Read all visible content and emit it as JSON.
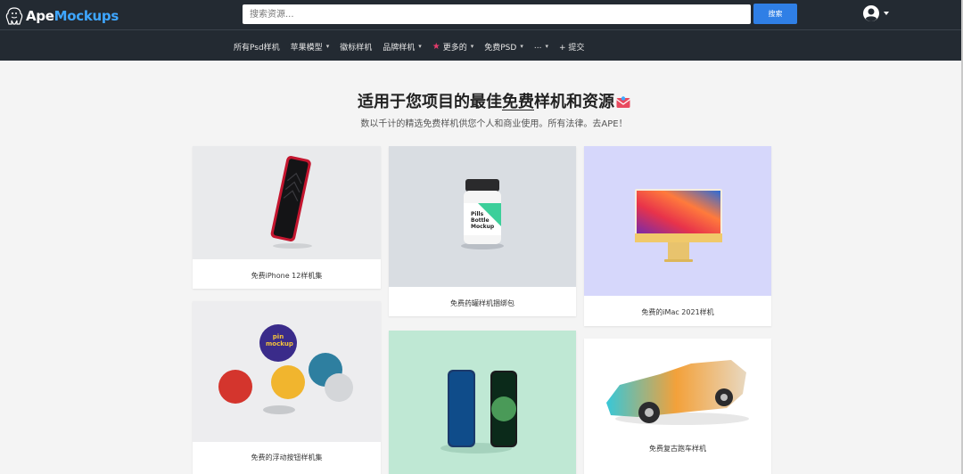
{
  "header": {
    "logo_prefix": "Ape",
    "logo_suffix": "Mockups",
    "search_placeholder": "搜索资源...",
    "search_button": "搜索"
  },
  "nav": {
    "items": [
      {
        "label": "所有Psd样机",
        "dropdown": false
      },
      {
        "label": "苹果模型",
        "dropdown": true
      },
      {
        "label": "徽标样机",
        "dropdown": false
      },
      {
        "label": "品牌样机",
        "dropdown": true
      },
      {
        "label": "更多的",
        "dropdown": true
      },
      {
        "label": "免费PSD",
        "dropdown": true
      },
      {
        "label": "...",
        "dropdown": true
      },
      {
        "label": "+ 提交",
        "dropdown": false
      }
    ]
  },
  "hero": {
    "title_part1": "适用于您项目的最佳",
    "title_highlight": "免费",
    "title_part2": "样机和资源",
    "subtitle": "数以千计的精选免费样机供您个人和商业使用。所有法律。去APE！"
  },
  "cards": [
    {
      "caption": "免费iPhone 12样机集"
    },
    {
      "caption": "免费药罐样机捆绑包"
    },
    {
      "caption": "免费的iMac 2021样机"
    },
    {
      "caption": "免费的浮动按钮样机集"
    },
    {
      "caption": ""
    },
    {
      "caption": "免费复古跑车样机"
    }
  ],
  "bottle_label": "Pills Bottle Mockup",
  "pin_label": "pin mockup",
  "colors": {
    "topbar": "#232a32",
    "accent": "#2f7fe6",
    "logo_accent": "#3ea6ff",
    "star": "#e33b6b"
  }
}
